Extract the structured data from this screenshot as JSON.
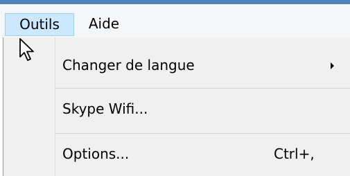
{
  "colors": {
    "title_strip": "#4f81bd",
    "menubar_bg": "#f5f6f7",
    "active_menu_bg": "#cce8ff",
    "active_menu_border": "#99d1ff",
    "dropdown_bg": "#f0f0f0"
  },
  "menubar": {
    "items": [
      {
        "label": "Outils",
        "state": "open"
      },
      {
        "label": "Aide",
        "state": "normal"
      }
    ]
  },
  "dropdown": {
    "items": [
      {
        "label": "Changer de langue",
        "shortcut": "",
        "has_submenu": true,
        "submenu_icon": "chevron-right-icon"
      },
      {
        "label": "Skype Wifi...",
        "shortcut": "",
        "has_submenu": false
      },
      {
        "label": "Options...",
        "shortcut": "Ctrl+,",
        "has_submenu": false
      }
    ]
  },
  "cursor": {
    "icon": "mouse-pointer-icon"
  }
}
